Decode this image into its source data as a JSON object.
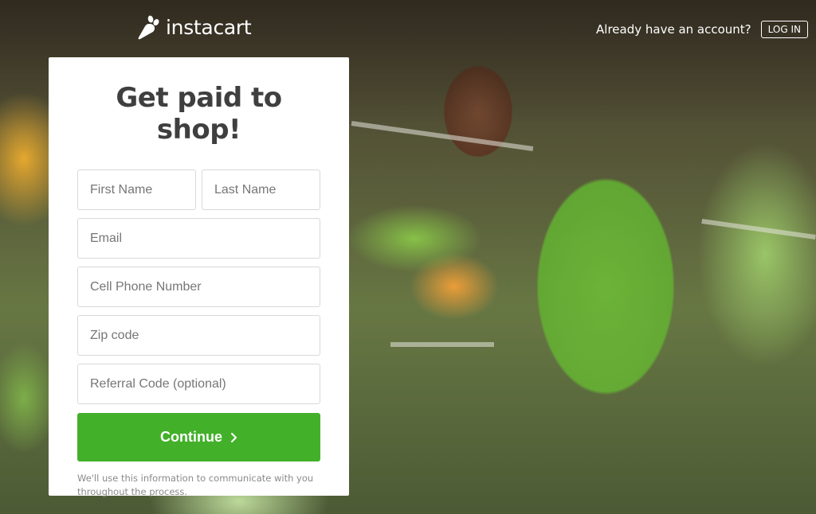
{
  "header": {
    "logo_text": "instacart",
    "logo_icon": "carrot-icon",
    "account_prompt": "Already have an account?",
    "login_label": "LOG IN"
  },
  "signup_form": {
    "title": "Get paid to shop!",
    "fields": {
      "first_name": {
        "value": "",
        "placeholder": "First Name"
      },
      "last_name": {
        "value": "",
        "placeholder": "Last Name"
      },
      "email": {
        "value": "",
        "placeholder": "Email"
      },
      "phone": {
        "value": "",
        "placeholder": "Cell Phone Number"
      },
      "zip": {
        "value": "",
        "placeholder": "Zip code"
      },
      "referral": {
        "value": "",
        "placeholder": "Referral Code (optional)"
      }
    },
    "continue_label": "Continue",
    "continue_icon": "chevron-right-icon",
    "disclaimer": "We'll use this information to communicate with you throughout the process."
  },
  "colors": {
    "brand_green": "#43b02a",
    "title_text": "#3f3f3f",
    "placeholder_text": "#767676"
  }
}
